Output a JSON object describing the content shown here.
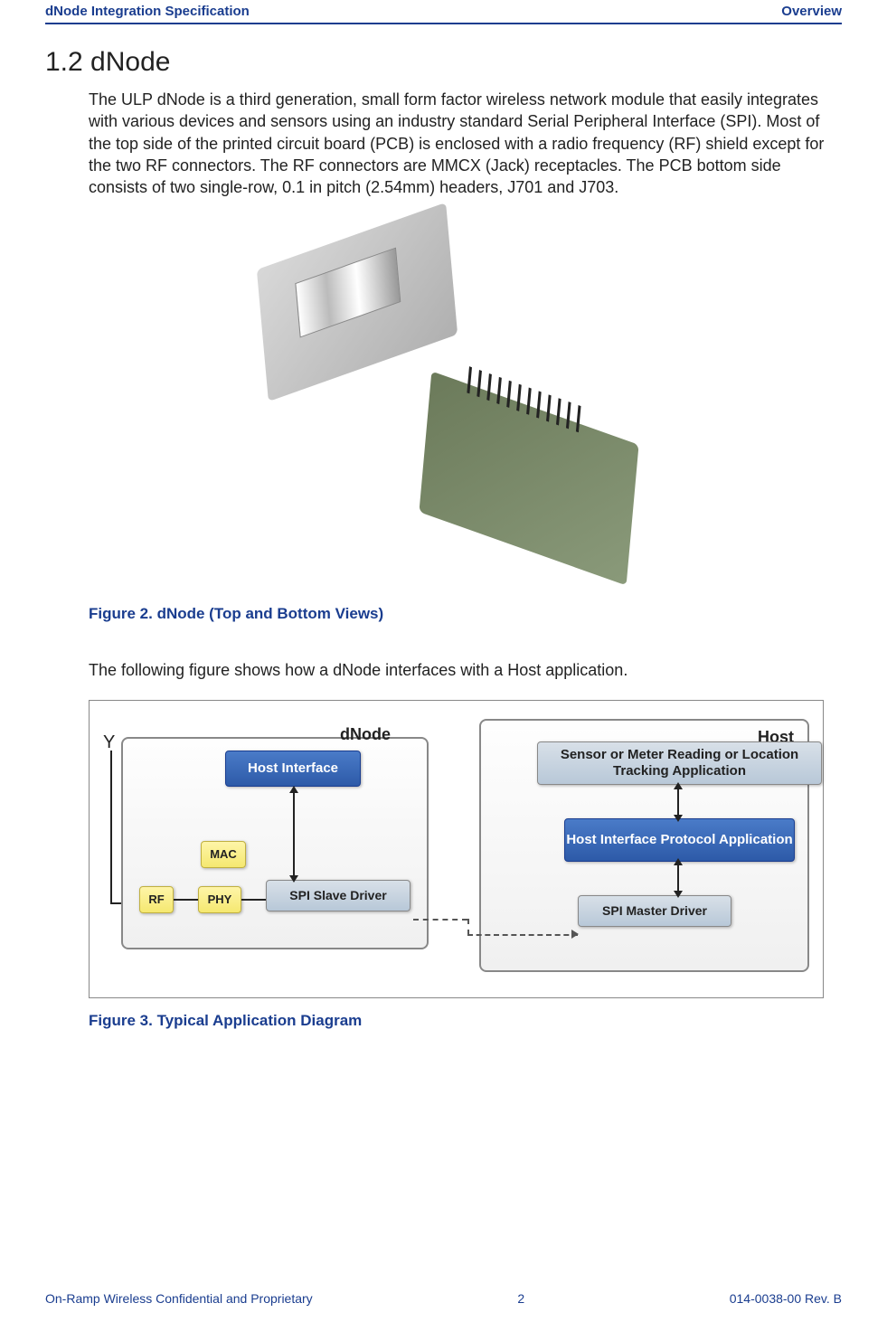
{
  "header": {
    "left": "dNode Integration Specification",
    "right": "Overview"
  },
  "section": {
    "number_title": "1.2 dNode",
    "body": "The ULP dNode is a third generation, small form factor wireless network module that easily integrates with various devices and sensors using an industry standard Serial Peripheral Interface (SPI). Most of the top side of the printed circuit board (PCB) is enclosed with a radio frequency (RF) shield except for the two RF connectors. The RF connectors are MMCX (Jack) receptacles. The PCB bottom side consists of two single-row, 0.1 in pitch (2.54mm) headers, J701 and J703."
  },
  "figure2_caption": "Figure 2. dNode (Top and Bottom Views)",
  "transition_text": "The following figure shows how a dNode interfaces with a Host application.",
  "diagram": {
    "dnode_label": "dNode",
    "host_label": "Host",
    "host_interface": "Host Interface",
    "mac": "MAC",
    "rf": "RF",
    "phy": "PHY",
    "spi_slave": "SPI Slave Driver",
    "sensor": "Sensor or Meter Reading or Location Tracking Application",
    "host_protocol": "Host Interface Protocol Application",
    "spi_master": "SPI Master Driver"
  },
  "figure3_caption": "Figure 3. Typical Application Diagram",
  "footer": {
    "left": "On-Ramp Wireless Confidential and Proprietary",
    "center": "2",
    "right": "014-0038-00 Rev. B"
  }
}
